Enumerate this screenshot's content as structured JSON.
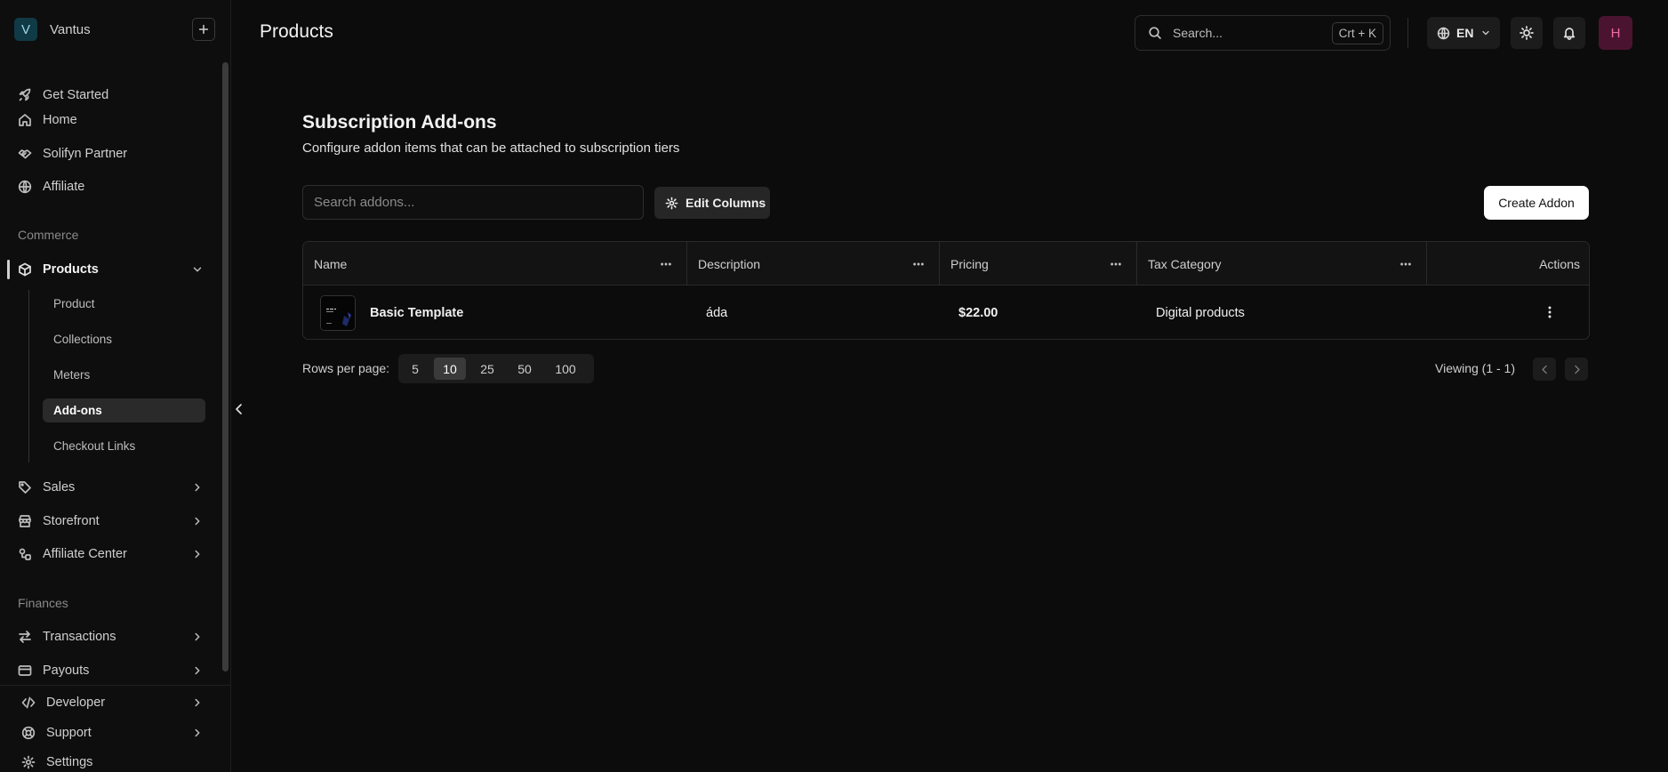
{
  "brand": {
    "initial": "V",
    "name": "Vantus"
  },
  "sidebar": {
    "items": [
      {
        "label": "Get Started",
        "icon": "rocket-icon"
      },
      {
        "label": "Home",
        "icon": "home-icon"
      },
      {
        "label": "Solifyn Partner",
        "icon": "handshake-icon"
      },
      {
        "label": "Affiliate",
        "icon": "globe-icon"
      }
    ],
    "commerce_label": "Commerce",
    "products": {
      "label": "Products",
      "icon": "package-icon"
    },
    "sub_items": [
      "Product",
      "Collections",
      "Meters",
      "Add-ons",
      "Checkout Links"
    ],
    "active_sub": "Add-ons",
    "commerce_items": [
      {
        "label": "Sales",
        "icon": "tag-icon"
      },
      {
        "label": "Storefront",
        "icon": "store-icon"
      },
      {
        "label": "Affiliate Center",
        "icon": "affiliate-center-icon"
      }
    ],
    "finances_label": "Finances",
    "finance_items": [
      {
        "label": "Transactions",
        "icon": "arrows-swap-icon"
      },
      {
        "label": "Payouts",
        "icon": "credit-card-icon"
      }
    ],
    "bottom_items": [
      {
        "label": "Developer",
        "icon": "code-icon"
      },
      {
        "label": "Support",
        "icon": "lifebuoy-icon"
      },
      {
        "label": "Settings",
        "icon": "gear-icon"
      }
    ]
  },
  "header": {
    "title": "Products",
    "search_placeholder": "Search...",
    "search_shortcut": "Crt + K",
    "language": "EN",
    "avatar_initial": "H"
  },
  "main": {
    "title": "Subscription Add-ons",
    "subtitle": "Configure addon items that can be attached to subscription tiers",
    "search_placeholder": "Search addons...",
    "edit_columns_label": "Edit Columns",
    "create_label": "Create Addon",
    "columns": [
      "Name",
      "Description",
      "Pricing",
      "Tax Category",
      "Actions"
    ],
    "rows": [
      {
        "name": "Basic Template",
        "description": "áda",
        "pricing": "$22.00",
        "tax_category": "Digital products"
      }
    ],
    "rows_per_page_label": "Rows per page:",
    "rows_per_page_options": [
      "5",
      "10",
      "25",
      "50",
      "100"
    ],
    "rows_per_page_selected": "10",
    "viewing_text": "Viewing (1 - 1)"
  },
  "colors": {
    "background": "#0c0c0c",
    "avatar_bg": "#4a1430",
    "avatar_fg": "#f06aa8",
    "brand_bg": "#103a46",
    "primary_button_bg": "#ffffff"
  }
}
